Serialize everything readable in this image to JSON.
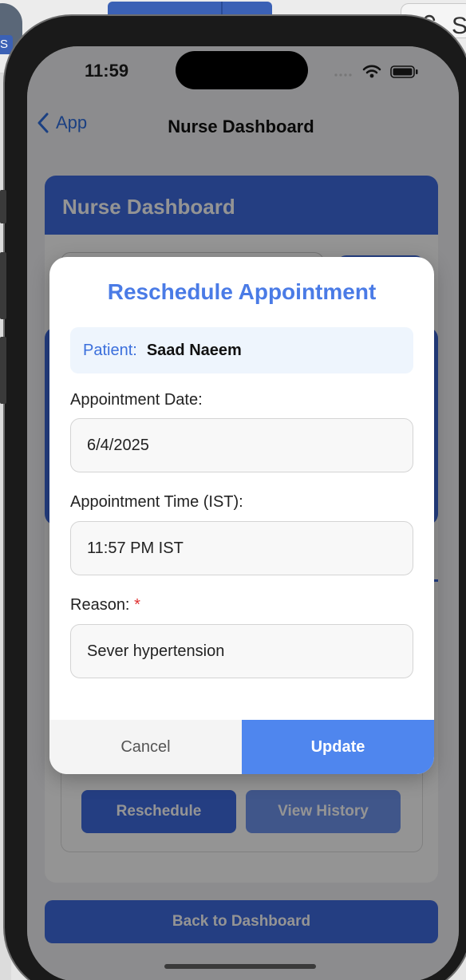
{
  "status_bar": {
    "time": "11:59"
  },
  "nav": {
    "back_label": "App",
    "title": "Nurse Dashboard"
  },
  "background": {
    "header_title": "Nurse Dashboard",
    "reschedule_label": "Reschedule",
    "history_label": "View History",
    "back_label": "Back to Dashboard"
  },
  "desktop": {
    "lock_letter": "S",
    "badge_letter": "S"
  },
  "modal": {
    "title": "Reschedule Appointment",
    "patient_label": "Patient:",
    "patient_name": "Saad Naeem",
    "date_label": "Appointment Date:",
    "date_value": "6/4/2025",
    "time_label": "Appointment Time (IST):",
    "time_value": "11:57 PM IST",
    "reason_label": "Reason:",
    "reason_required": "*",
    "reason_value": "Sever hypertension",
    "cancel_label": "Cancel",
    "update_label": "Update"
  },
  "colors": {
    "primary": "#3e6be0",
    "accent": "#4f86ee",
    "title": "#4a7be6",
    "required": "#e03131"
  }
}
